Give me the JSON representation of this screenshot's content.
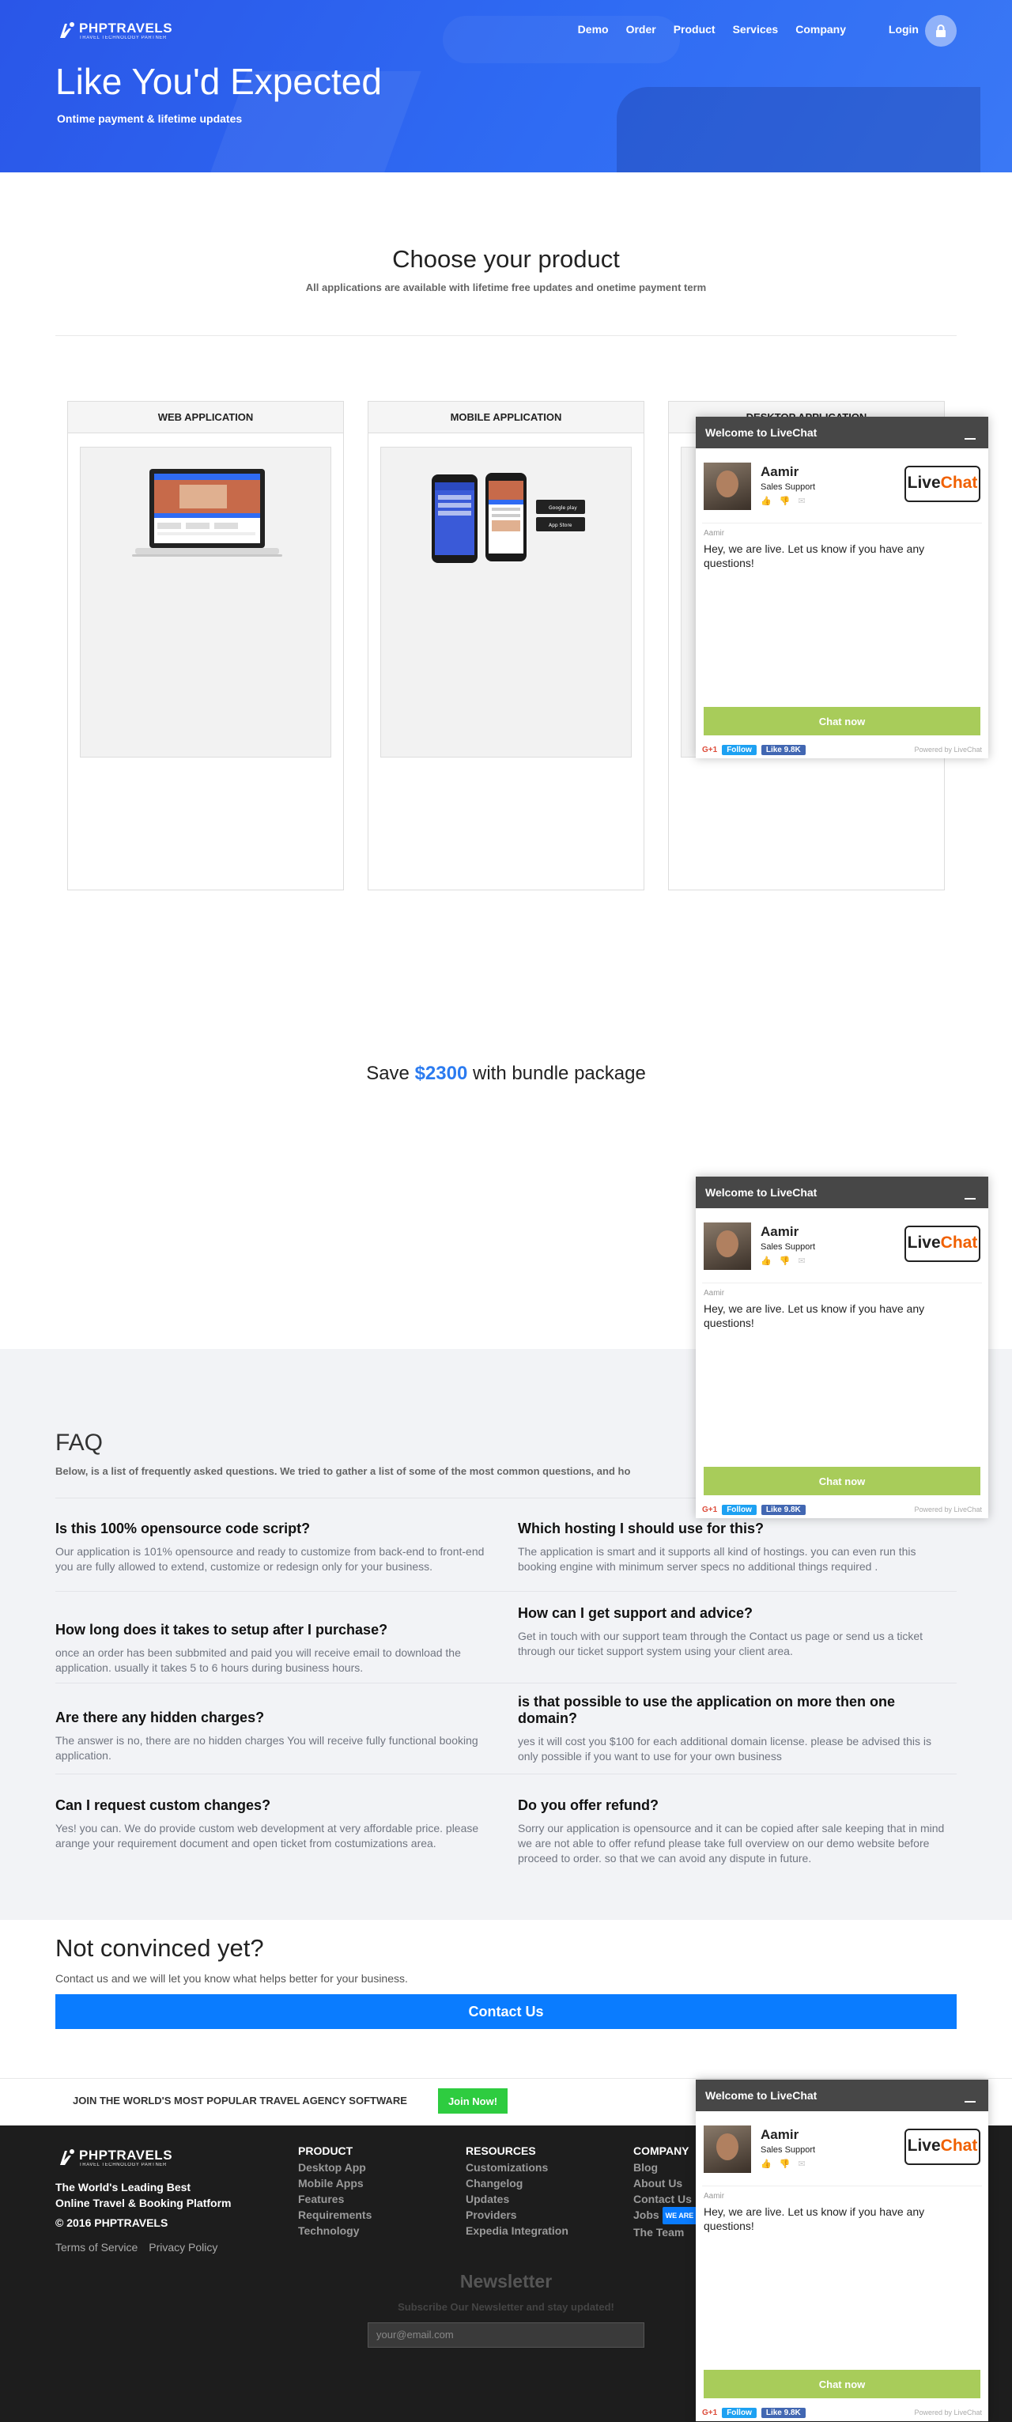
{
  "header": {
    "logo_text": "PHPTRAVELS",
    "logo_sub": "TRAVEL TECHNOLOGY PARTNER",
    "nav": [
      "Demo",
      "Order",
      "Product",
      "Services",
      "Company"
    ],
    "login": "Login"
  },
  "hero": {
    "title": "Like You'd Expected",
    "subtitle": "Ontime payment & lifetime updates"
  },
  "products": {
    "title": "Choose your product",
    "subtitle": "All applications are available with lifetime free updates and onetime payment term",
    "cards": [
      {
        "label": "WEB APPLICATION"
      },
      {
        "label": "MOBILE APPLICATION"
      },
      {
        "label": "DESKTOP APPLICATION"
      }
    ]
  },
  "bundle": {
    "prefix": "Save",
    "price": "$2300",
    "suffix": "with bundle package"
  },
  "faq": {
    "title": "FAQ",
    "intro": "Below, is a list of frequently asked questions. We tried to gather a list of some of the most common questions, and ho",
    "items": [
      {
        "q": "Is this 100% opensource code script?",
        "a": "Our application is 101% opensource and ready to customize from back-end to front-end you are fully allowed to extend, customize or redesign only for your business."
      },
      {
        "q": "Which hosting I should use for this?",
        "a": "The application is smart and it supports all kind of hostings. you can even run this booking engine with minimum server specs no additional things required ."
      },
      {
        "q": "How long does it takes to setup after I purchase?",
        "a": "once an order has been subbmited and paid you will receive email to download the application. usually it takes 5 to 6 hours during business hours."
      },
      {
        "q": "How can I get support and advice?",
        "a": "Get in touch with our support team through the Contact us page or send us a ticket through our ticket support system using your client area."
      },
      {
        "q": "Are there any hidden charges?",
        "a": "The answer is no, there are no hidden charges You will receive fully functional booking application."
      },
      {
        "q": "is that possible to use the application on more then one domain?",
        "a": "yes it will cost you $100 for each additional domain license. please be advised this is only possible if you want to use for your own business"
      },
      {
        "q": "Can I request custom changes?",
        "a": "Yes! you can. We do provide custom web development at very affordable price. please arange your requirement document and open ticket from costumizations area."
      },
      {
        "q": "Do you offer refund?",
        "a": "Sorry our application is opensource and it can be copied after sale keeping that in mind we are not able to offer refund please take full overview on our demo website before proceed to order. so that we can avoid any dispute in future."
      }
    ]
  },
  "not_convinced": {
    "title": "Not convinced yet?",
    "subtitle": "Contact us and we will let you know what helps better for your business.",
    "button": "Contact Us"
  },
  "join": {
    "text": "JOIN THE WORLD'S MOST POPULAR TRAVEL AGENCY SOFTWARE",
    "button": "Join Now!"
  },
  "footer": {
    "logo_text": "PHPTRAVELS",
    "logo_sub": "TRAVEL TECHNOLOGY PARTNER",
    "tagline1": "The World's Leading Best",
    "tagline2": "Online Travel & Booking Platform",
    "copyright": "© 2016 PHPTRAVELS",
    "terms": "Terms of Service",
    "privacy": "Privacy Policy",
    "columns": [
      {
        "title": "PRODUCT",
        "items": [
          "Desktop App",
          "Mobile Apps",
          "Features",
          "Requirements",
          "Technology"
        ]
      },
      {
        "title": "RESOURCES",
        "items": [
          "Customizations",
          "Changelog",
          "Updates",
          "Providers",
          "Expedia Integration"
        ]
      },
      {
        "title": "COMPANY",
        "items": [
          "Blog",
          "About Us",
          "Contact Us",
          "Jobs",
          "The Team"
        ]
      }
    ],
    "we_are_badge": "WE ARE",
    "newsletter": {
      "title": "Newsletter",
      "subtitle": "Subscribe Our Newsletter and stay updated!",
      "placeholder": "your@email.com"
    }
  },
  "livechat": {
    "title": "Welcome to LiveChat",
    "agent_name": "Aamir",
    "agent_role": "Sales Support",
    "brand_live": "Live",
    "brand_chat": "Chat",
    "from": "Aamir",
    "message": "Hey, we are live. Let us know if you have any questions!",
    "button": "Chat now",
    "gplus": "G+1",
    "twitter": "Follow",
    "facebook": "Like 9.8K",
    "powered": "Powered by LiveChat"
  },
  "colors": {
    "hero_blue": "#2f6bf3",
    "accent_blue": "#0a7cff",
    "join_green": "#2ecc40",
    "chat_green": "#a8cc5a",
    "footer_bg": "#1d1d1d"
  }
}
